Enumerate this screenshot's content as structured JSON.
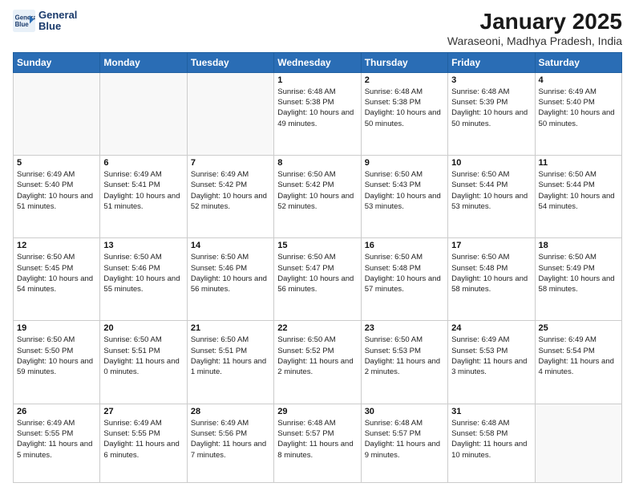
{
  "logo": {
    "text_line1": "General",
    "text_line2": "Blue"
  },
  "header": {
    "month_year": "January 2025",
    "location": "Waraseoni, Madhya Pradesh, India"
  },
  "weekdays": [
    "Sunday",
    "Monday",
    "Tuesday",
    "Wednesday",
    "Thursday",
    "Friday",
    "Saturday"
  ],
  "weeks": [
    [
      {
        "day": "",
        "info": ""
      },
      {
        "day": "",
        "info": ""
      },
      {
        "day": "",
        "info": ""
      },
      {
        "day": "1",
        "info": "Sunrise: 6:48 AM\nSunset: 5:38 PM\nDaylight: 10 hours\nand 49 minutes."
      },
      {
        "day": "2",
        "info": "Sunrise: 6:48 AM\nSunset: 5:38 PM\nDaylight: 10 hours\nand 50 minutes."
      },
      {
        "day": "3",
        "info": "Sunrise: 6:48 AM\nSunset: 5:39 PM\nDaylight: 10 hours\nand 50 minutes."
      },
      {
        "day": "4",
        "info": "Sunrise: 6:49 AM\nSunset: 5:40 PM\nDaylight: 10 hours\nand 50 minutes."
      }
    ],
    [
      {
        "day": "5",
        "info": "Sunrise: 6:49 AM\nSunset: 5:40 PM\nDaylight: 10 hours\nand 51 minutes."
      },
      {
        "day": "6",
        "info": "Sunrise: 6:49 AM\nSunset: 5:41 PM\nDaylight: 10 hours\nand 51 minutes."
      },
      {
        "day": "7",
        "info": "Sunrise: 6:49 AM\nSunset: 5:42 PM\nDaylight: 10 hours\nand 52 minutes."
      },
      {
        "day": "8",
        "info": "Sunrise: 6:50 AM\nSunset: 5:42 PM\nDaylight: 10 hours\nand 52 minutes."
      },
      {
        "day": "9",
        "info": "Sunrise: 6:50 AM\nSunset: 5:43 PM\nDaylight: 10 hours\nand 53 minutes."
      },
      {
        "day": "10",
        "info": "Sunrise: 6:50 AM\nSunset: 5:44 PM\nDaylight: 10 hours\nand 53 minutes."
      },
      {
        "day": "11",
        "info": "Sunrise: 6:50 AM\nSunset: 5:44 PM\nDaylight: 10 hours\nand 54 minutes."
      }
    ],
    [
      {
        "day": "12",
        "info": "Sunrise: 6:50 AM\nSunset: 5:45 PM\nDaylight: 10 hours\nand 54 minutes."
      },
      {
        "day": "13",
        "info": "Sunrise: 6:50 AM\nSunset: 5:46 PM\nDaylight: 10 hours\nand 55 minutes."
      },
      {
        "day": "14",
        "info": "Sunrise: 6:50 AM\nSunset: 5:46 PM\nDaylight: 10 hours\nand 56 minutes."
      },
      {
        "day": "15",
        "info": "Sunrise: 6:50 AM\nSunset: 5:47 PM\nDaylight: 10 hours\nand 56 minutes."
      },
      {
        "day": "16",
        "info": "Sunrise: 6:50 AM\nSunset: 5:48 PM\nDaylight: 10 hours\nand 57 minutes."
      },
      {
        "day": "17",
        "info": "Sunrise: 6:50 AM\nSunset: 5:48 PM\nDaylight: 10 hours\nand 58 minutes."
      },
      {
        "day": "18",
        "info": "Sunrise: 6:50 AM\nSunset: 5:49 PM\nDaylight: 10 hours\nand 58 minutes."
      }
    ],
    [
      {
        "day": "19",
        "info": "Sunrise: 6:50 AM\nSunset: 5:50 PM\nDaylight: 10 hours\nand 59 minutes."
      },
      {
        "day": "20",
        "info": "Sunrise: 6:50 AM\nSunset: 5:51 PM\nDaylight: 11 hours\nand 0 minutes."
      },
      {
        "day": "21",
        "info": "Sunrise: 6:50 AM\nSunset: 5:51 PM\nDaylight: 11 hours\nand 1 minute."
      },
      {
        "day": "22",
        "info": "Sunrise: 6:50 AM\nSunset: 5:52 PM\nDaylight: 11 hours\nand 2 minutes."
      },
      {
        "day": "23",
        "info": "Sunrise: 6:50 AM\nSunset: 5:53 PM\nDaylight: 11 hours\nand 2 minutes."
      },
      {
        "day": "24",
        "info": "Sunrise: 6:49 AM\nSunset: 5:53 PM\nDaylight: 11 hours\nand 3 minutes."
      },
      {
        "day": "25",
        "info": "Sunrise: 6:49 AM\nSunset: 5:54 PM\nDaylight: 11 hours\nand 4 minutes."
      }
    ],
    [
      {
        "day": "26",
        "info": "Sunrise: 6:49 AM\nSunset: 5:55 PM\nDaylight: 11 hours\nand 5 minutes."
      },
      {
        "day": "27",
        "info": "Sunrise: 6:49 AM\nSunset: 5:55 PM\nDaylight: 11 hours\nand 6 minutes."
      },
      {
        "day": "28",
        "info": "Sunrise: 6:49 AM\nSunset: 5:56 PM\nDaylight: 11 hours\nand 7 minutes."
      },
      {
        "day": "29",
        "info": "Sunrise: 6:48 AM\nSunset: 5:57 PM\nDaylight: 11 hours\nand 8 minutes."
      },
      {
        "day": "30",
        "info": "Sunrise: 6:48 AM\nSunset: 5:57 PM\nDaylight: 11 hours\nand 9 minutes."
      },
      {
        "day": "31",
        "info": "Sunrise: 6:48 AM\nSunset: 5:58 PM\nDaylight: 11 hours\nand 10 minutes."
      },
      {
        "day": "",
        "info": ""
      }
    ]
  ]
}
